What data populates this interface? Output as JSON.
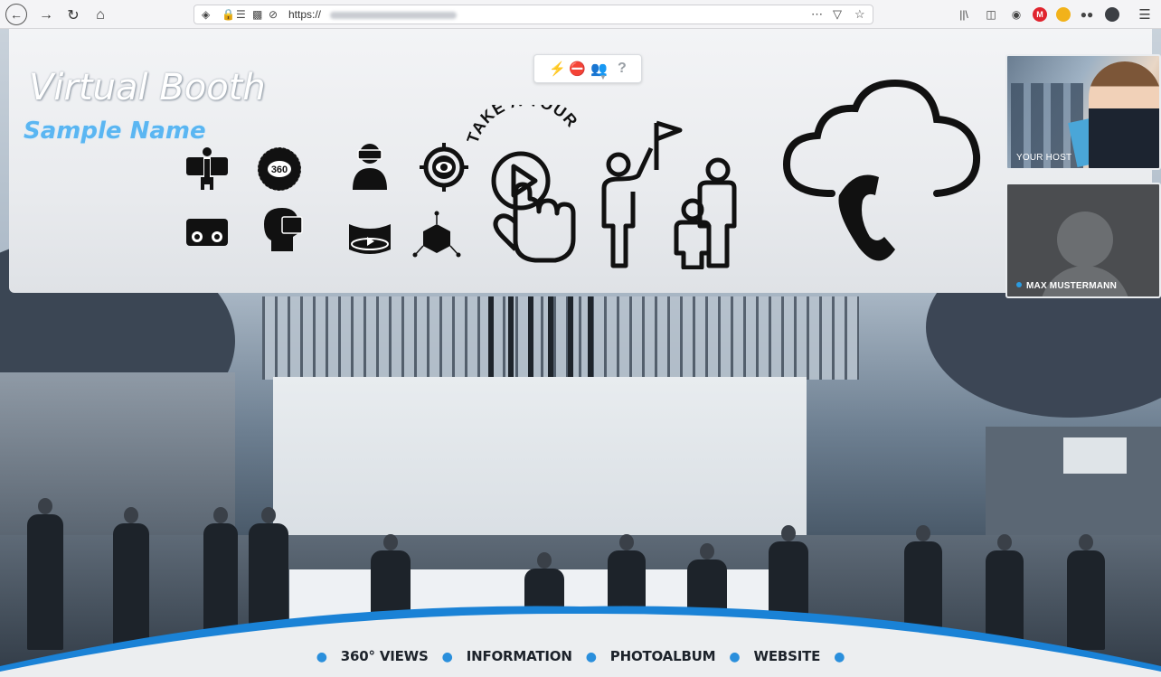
{
  "browser": {
    "url": "https://",
    "icons": [
      "back-icon",
      "forward-icon",
      "reload-icon",
      "home-icon",
      "shield-icon",
      "lock-icon",
      "permissions-icon",
      "reader-icon",
      "camera-blocked-icon",
      "more-icon",
      "pocket-icon",
      "bookmark-star-icon",
      "library-icon",
      "sidebar-icon",
      "account-icon",
      "extension-m-icon",
      "extension-icon",
      "extension-2-icon",
      "extension-3-icon",
      "menu-icon"
    ]
  },
  "banner": {
    "title": "Virtual Booth",
    "subtitle": "Sample Name",
    "tour_label": "TAKE A TOUR"
  },
  "toolbar": {
    "question": "?"
  },
  "video": {
    "host_label": "YOUR HOST",
    "participant_label": "MAX MUSTERMANN"
  },
  "bottom_nav": {
    "items": [
      "360° VIEWS",
      "INFORMATION",
      "PHOTOALBUM",
      "WEBSITE"
    ]
  },
  "colors": {
    "accent": "#2b8fd8",
    "subtitle": "#5ab6f2"
  }
}
